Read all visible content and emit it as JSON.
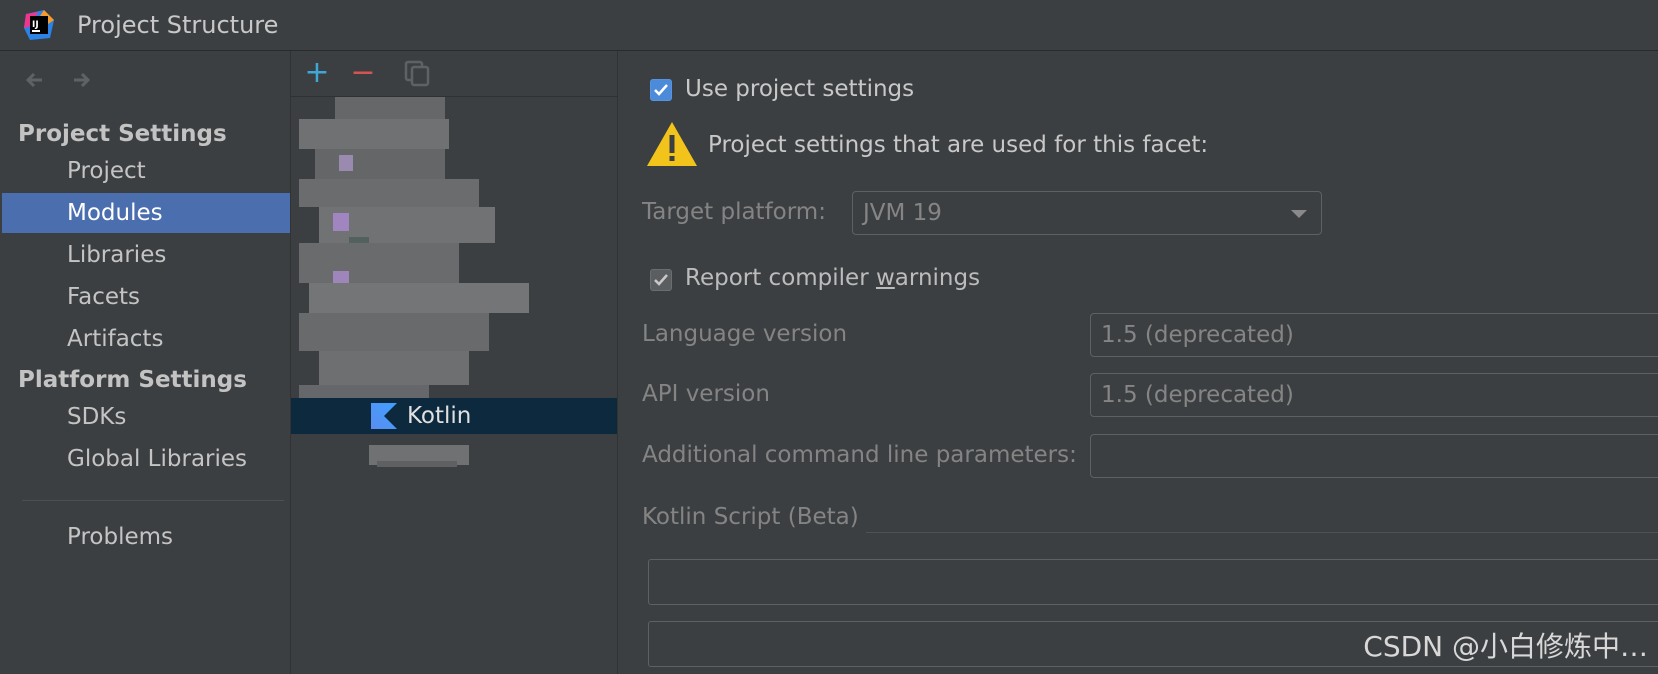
{
  "window": {
    "title": "Project Structure",
    "logo_text": "IJ"
  },
  "sidebar": {
    "sections": [
      {
        "header": "Project Settings",
        "items": [
          "Project",
          "Modules",
          "Libraries",
          "Facets",
          "Artifacts"
        ]
      },
      {
        "header": "Platform Settings",
        "items": [
          "SDKs",
          "Global Libraries"
        ]
      }
    ],
    "problems": "Problems",
    "selected": "Modules"
  },
  "tree": {
    "toolbar": {
      "add": "+",
      "remove": "−"
    },
    "selected_node": "Kotlin"
  },
  "facet": {
    "use_project_settings": {
      "label": "Use project settings",
      "checked": true
    },
    "warning_text": "Project settings that are used for this facet:",
    "target_platform": {
      "label": "Target platform:",
      "value": "JVM 19"
    },
    "report_warnings": {
      "label_pre": "Report compiler ",
      "label_mnemonic": "w",
      "label_post": "arnings",
      "checked": true
    },
    "language_version": {
      "label": "Language version",
      "value": "1.5 (deprecated)"
    },
    "api_version": {
      "label": "API version",
      "value": "1.5 (deprecated)"
    },
    "additional_params": {
      "label": "Additional command line parameters:",
      "value": ""
    },
    "kotlin_script": {
      "label": "Kotlin Script (Beta)"
    }
  },
  "watermark": "CSDN @小白修炼中…",
  "colors": {
    "background": "#3c3f41",
    "selection": "#4b6eaf",
    "tree_selection": "#0d293e",
    "checkbox": "#4c8bd9",
    "warning": "#f2c41b",
    "add": "#3fa6d8",
    "remove": "#d65353"
  }
}
